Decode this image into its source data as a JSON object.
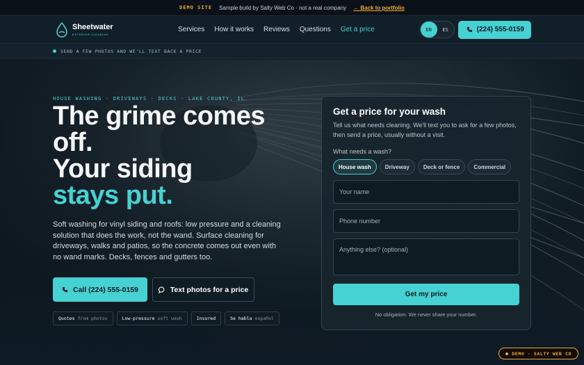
{
  "demo_bar": {
    "tag": "DEMO SITE",
    "text": "Sample build by Salty Web Co · not a real company",
    "back_link": "← Back to portfolio"
  },
  "brand": {
    "name": "Sheetwater",
    "tagline": "EXTERIOR CLEANING",
    "accent_color": "#46d1d3",
    "demo_color": "#f0a93b"
  },
  "nav": {
    "items": [
      "Services",
      "How it works",
      "Reviews",
      "Questions"
    ],
    "cta": "Get a price"
  },
  "language": {
    "options": [
      "EN",
      "ES"
    ],
    "selected": "EN"
  },
  "header_call": "(224) 555-0159",
  "ticker": "SEND A FEW PHOTOS AND WE'LL TEXT BACK A PRICE",
  "hero": {
    "eyebrow": "HOUSE WASHING · DRIVEWAYS · DECKS · LAKE COUNTY, IL",
    "title_line1": "The grime comes off.",
    "title_line2": "Your siding",
    "title_accent": "stays put.",
    "lede": "Soft washing for vinyl siding and roofs: low pressure and a cleaning solution that does the work, not the wand. Surface cleaning for driveways, walks and patios, so the concrete comes out even with no wand marks. Decks, fences and gutters too.",
    "call_button": "Call (224) 555-0159",
    "text_button": "Text photos for a price",
    "chips": [
      {
        "strong": "Quotes",
        "muted": "from photos"
      },
      {
        "strong": "Low-pressure",
        "muted": "soft wash"
      },
      {
        "strong": "Insured",
        "muted": ""
      },
      {
        "strong": "Se habla",
        "muted": "español"
      }
    ]
  },
  "form": {
    "title": "Get a price for your wash",
    "description": "Tell us what needs cleaning. We'll text you to ask for a few photos, then send a price, usually without a visit.",
    "question": "What needs a wash?",
    "options": [
      "House wash",
      "Driveway",
      "Deck or fence",
      "Commercial"
    ],
    "selected_option": "House wash",
    "name_placeholder": "Your name",
    "phone_placeholder": "Phone number",
    "notes_placeholder": "Anything else? (optional)",
    "submit": "Get my price",
    "note": "No obligation. We never share your number."
  },
  "demo_badge": "DEMO · SALTY WEB CO"
}
